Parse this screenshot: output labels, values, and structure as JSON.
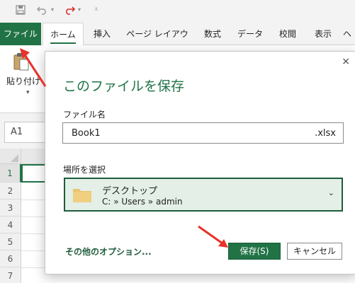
{
  "ribbon": {
    "tabs": [
      "ファイル",
      "ホーム",
      "挿入",
      "ページ レイアウト",
      "数式",
      "データ",
      "校閲",
      "表示",
      "ヘ"
    ],
    "paste_label": "貼り付け"
  },
  "formula_bar": {
    "name_box": "A1"
  },
  "grid": {
    "rows": [
      "1",
      "2",
      "3",
      "4",
      "5",
      "6",
      "7"
    ]
  },
  "dialog": {
    "title": "このファイルを保存",
    "close_glyph": "×",
    "filename_label": "ファイル名",
    "filename_value": "Book1",
    "filename_ext": ".xlsx",
    "location_label": "場所を選択",
    "location_name": "デスクトップ",
    "location_path": "C: » Users » admin",
    "more_options": "その他のオプション...",
    "save_button": "保存(S)",
    "cancel_button": "キャンセル"
  },
  "colors": {
    "accent": "#217346",
    "annotation_arrow": "#e8322a"
  }
}
